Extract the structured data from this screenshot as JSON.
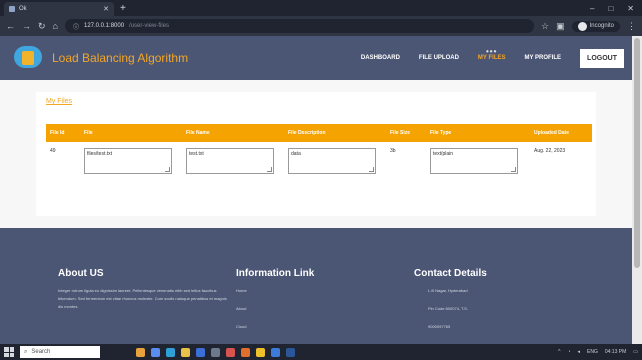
{
  "browser": {
    "tab_title": "Ok",
    "new_tab_icon": "plus-icon",
    "url_host": "127.0.0.1:8000",
    "url_path": "/user-view-files",
    "profile_label": "Incognito",
    "window_controls": [
      "–",
      "□",
      "✕"
    ]
  },
  "app": {
    "brand": "Load Balancing Algorithm",
    "nav": {
      "dashboard": "DASHBOARD",
      "file_upload": "FILE UPLOAD",
      "my_files": "MY FILES",
      "my_profile": "MY PROFILE",
      "logout": "LOGOUT"
    },
    "colors": {
      "header": "#4b5674",
      "accent": "#f5a623",
      "table_header": "#f5a300"
    }
  },
  "page": {
    "breadcrumb": "My Files",
    "table": {
      "columns": [
        "File Id",
        "File",
        "File Name",
        "File Description",
        "File Size",
        "File Type",
        "Uploaded Date"
      ],
      "rows": [
        {
          "file_id": "49",
          "file": "files/test.txt",
          "file_name": "test.txt",
          "file_description": "data",
          "file_size": "3b",
          "file_type": "text/plain",
          "uploaded_date": "Aug. 22, 2023"
        }
      ]
    }
  },
  "footer": {
    "about": {
      "title": "About US",
      "text": "Integer rutrum ligula eu dignissim laoreet. Pellentesque venenatis nibh sed tellus faucibus bibendum. Sed fermentum est vitae rhoncus molestie. Cum sociis natoque penatibus et magnis dis montes."
    },
    "links": {
      "title": "Information Link",
      "items": [
        "Home",
        "About",
        "Cloud"
      ]
    },
    "contact": {
      "title": "Contact Details",
      "address": "L.B Nagar, Hyderabad",
      "pincode": "Pin Code:500074, T.S.",
      "phone": "9000097765"
    }
  },
  "taskbar": {
    "search_placeholder": "Search",
    "time": "04:13 PM",
    "lang": "ENG"
  }
}
